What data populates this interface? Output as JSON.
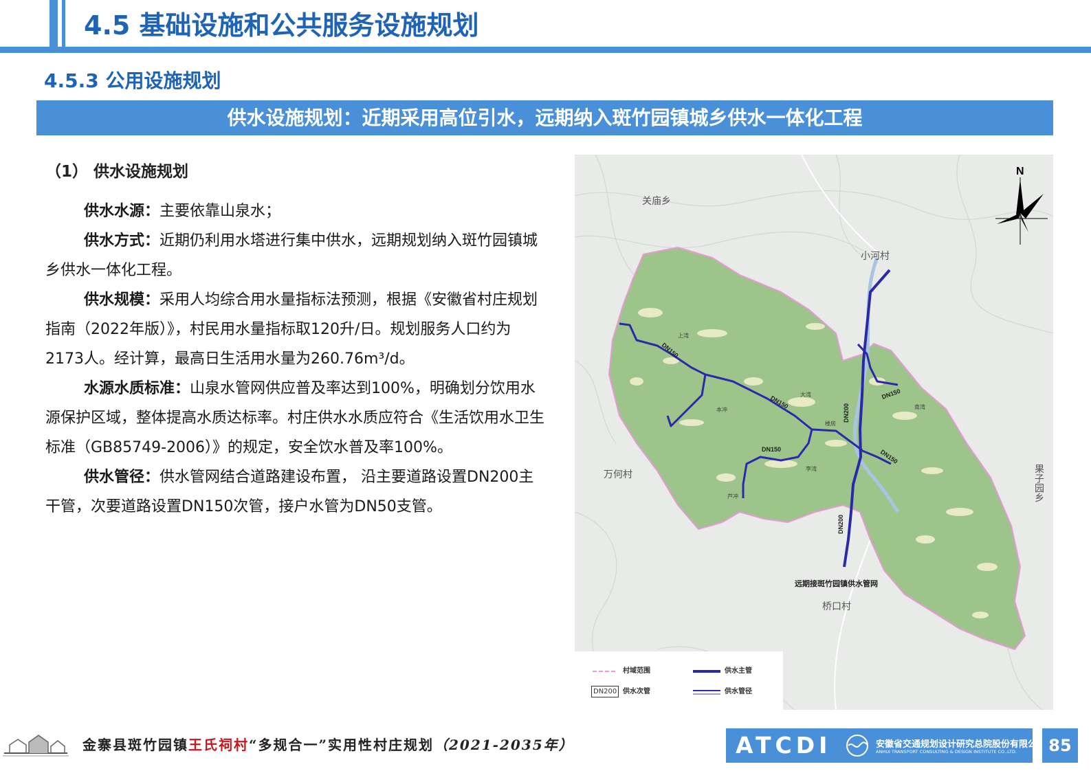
{
  "header": {
    "title": "4.5 基础设施和公共服务设施规划",
    "subtitle": "4.5.3  公用设施规划",
    "banner": "供水设施规划：近期采用高位引水，远期纳入斑竹园镇城乡供水一体化工程"
  },
  "content": {
    "heading": "（1） 供水设施规划",
    "paragraphs": [
      {
        "label": "供水水源：",
        "text": "主要依靠山泉水；"
      },
      {
        "label": "供水方式：",
        "text": "近期仍利用水塔进行集中供水，远期规划纳入斑竹园镇城乡供水一体化工程。"
      },
      {
        "label": "供水规模：",
        "text": "采用人均综合用水量指标法预测，根据《安徽省村庄规划指南（2022年版）》，村民用水量指标取120升/日。规划服务人口约为2173人。经计算，最高日生活用水量为260.76m³/d。"
      },
      {
        "label": "水源水质标准：",
        "text": "山泉水管网供应普及率达到100%，明确划分饮用水源保护区域，整体提高水质达标率。村庄供水水质应符合《生活饮用水卫生标准（GB85749-2006）》的规定，安全饮水普及率100%。"
      },
      {
        "label": "供水管径：",
        "text": "供水管网结合道路建设布置， 沿主要道路设置DN200主干管，次要道路设置DN150次管，接户水管为DN50支管。"
      }
    ]
  },
  "map": {
    "compass_label": "N",
    "place_labels": {
      "guanmiao": "关庙乡",
      "xiaohe": "小河村",
      "wanhe": "万何村",
      "guoziyuan": "果子园乡",
      "qiaokou": "桥口村"
    },
    "small_labels": {
      "shangwan": "上湾",
      "dawan": "大湾",
      "benchong": "本冲",
      "loufang": "楼房",
      "nanwan": "南湾",
      "liwan": "李湾",
      "luchong": "芦冲"
    },
    "pipe_labels": {
      "dn150_a": "DN150",
      "dn150_b": "DN150",
      "dn150_c": "DN150",
      "dn150_d": "DN150",
      "dn150_e": "DN150",
      "dn200_a": "DN200",
      "dn200_b": "DN200"
    },
    "future_label": "远期接斑竹园镇供水管网",
    "colors": {
      "village_fill": "#9dc48a",
      "pipe": "#2a2aa8",
      "boundary": "#e89ad8",
      "river": "#a9c4e0"
    },
    "legend": {
      "boundary": "村域范围",
      "main_pipe": "供水主管",
      "dn_box": "DN200",
      "secondary_pipe": "供水次管",
      "pipeline": "供水管径"
    }
  },
  "footer": {
    "title_a": "金寨县斑竹园镇",
    "title_hl": "王氏祠村",
    "title_b": "“多规合一”实用性村庄规划",
    "title_years": "（2021-2035年）",
    "org_logo": "ATCDI",
    "org_cn": "安徽省交通规划设计研究总院股份有限公司",
    "org_en": "ANHUI TRANSPORT CONSULTING & DESIGN INSTITUTE CO.,LTD.",
    "page": "85"
  }
}
